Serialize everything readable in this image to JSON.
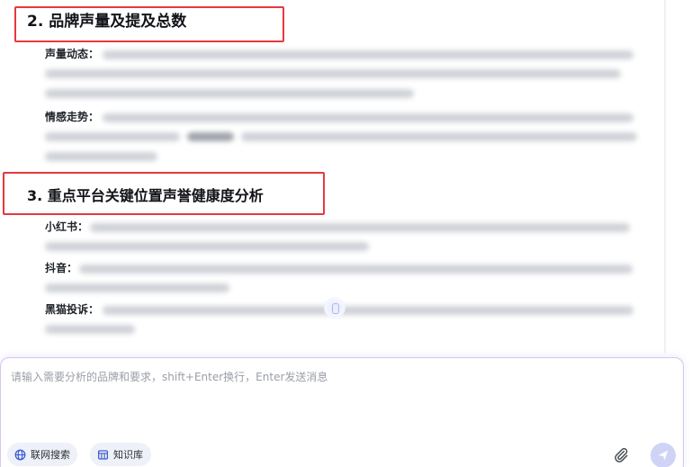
{
  "sections": [
    {
      "title": "2. 品牌声量及提及总数",
      "items": [
        {
          "label": "声量动态："
        },
        {
          "label": "情感走势："
        }
      ]
    },
    {
      "title": "3. 重点平台关键位置声誉健康度分析",
      "items": [
        {
          "label": "小红书："
        },
        {
          "label": "抖音："
        },
        {
          "label": "黑猫投诉："
        }
      ]
    }
  ],
  "input": {
    "placeholder": "请输入需要分析的品牌和要求，shift+Enter换行，Enter发送消息"
  },
  "toolbar": {
    "web_search_label": "联网搜索",
    "knowledge_base_label": "知识库"
  },
  "icons": {
    "web_search": "globe-icon",
    "knowledge_base": "book-icon",
    "attach": "paperclip-icon",
    "send": "send-arrow-icon"
  },
  "colors": {
    "highlight": "#e5393f",
    "accent": "#7b61d9",
    "send_button": "#cfd3f6"
  }
}
